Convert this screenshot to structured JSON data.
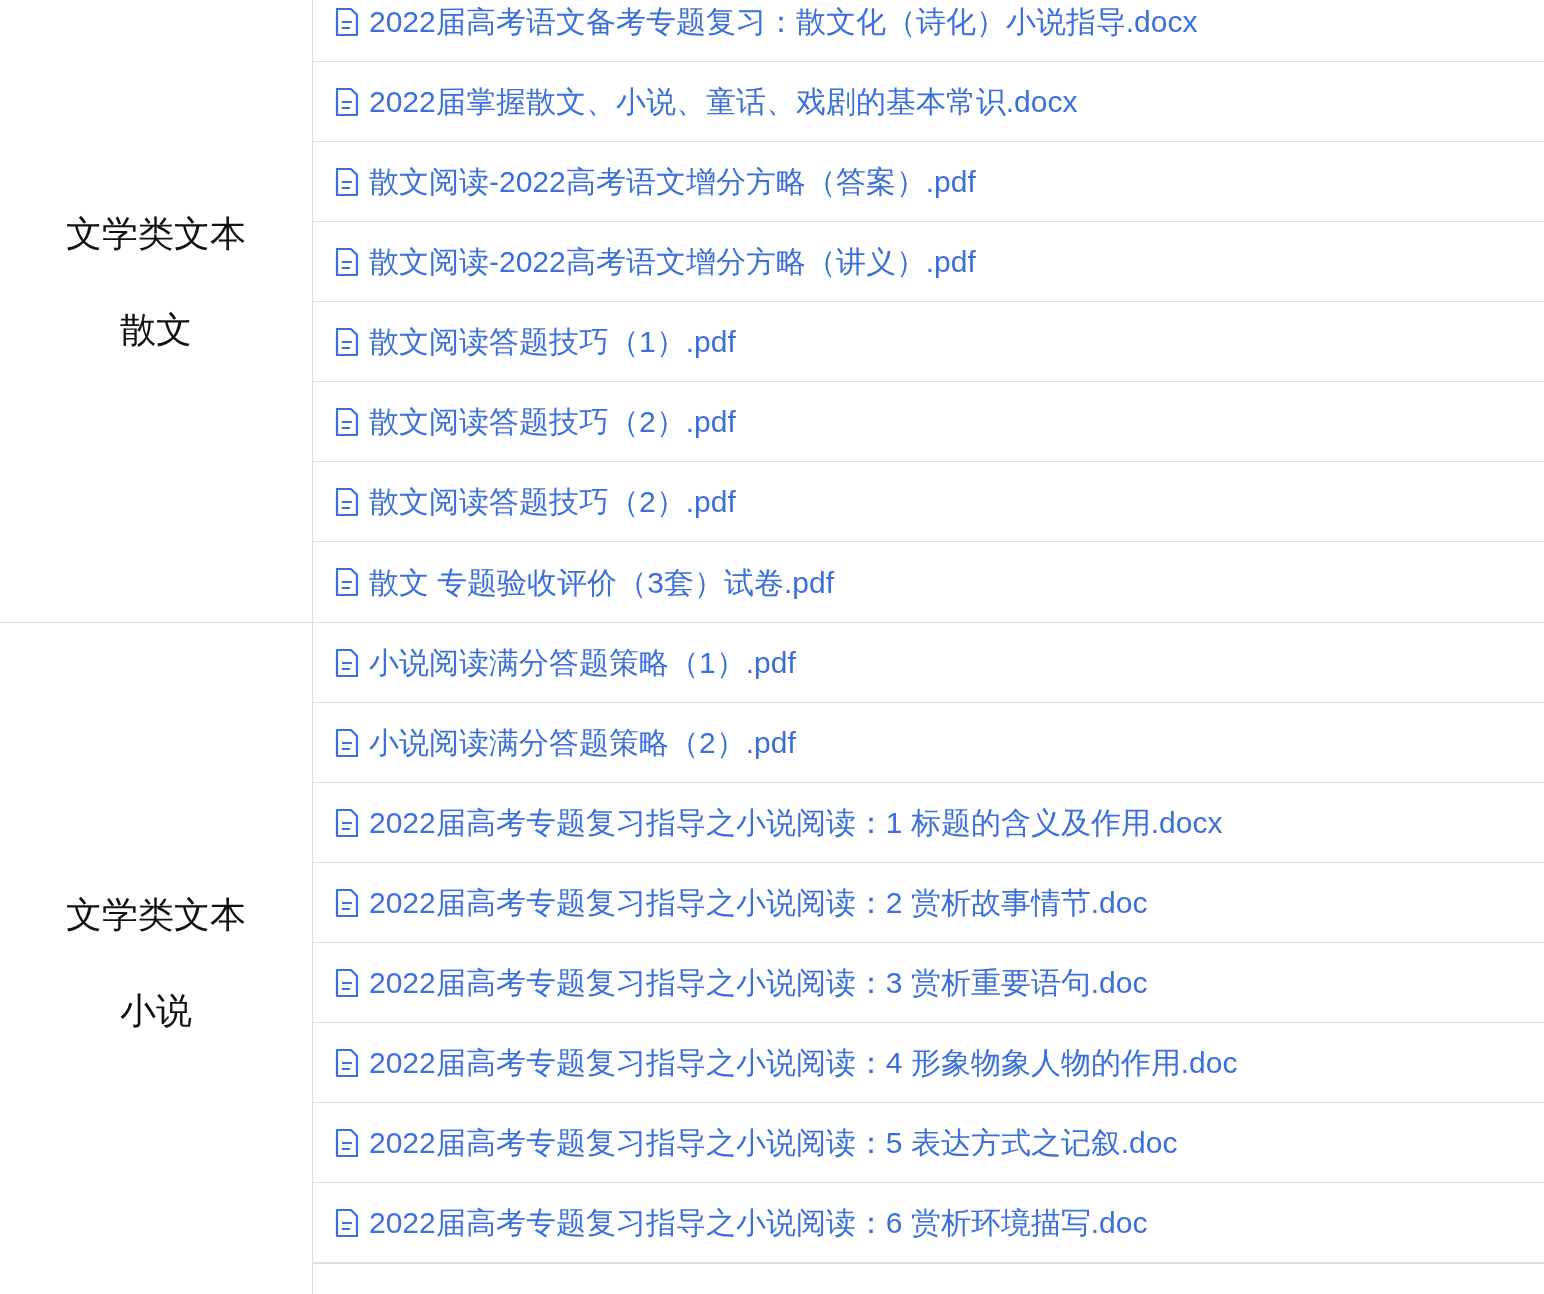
{
  "groups": [
    {
      "category": [
        "文学类文本",
        "散文"
      ],
      "files": [
        "2022届高考语文备考专题复习：散文化（诗化）小说指导.docx",
        "2022届掌握散文、小说、童话、戏剧的基本常识.docx",
        "散文阅读-2022高考语文增分方略（答案）.pdf",
        "散文阅读-2022高考语文增分方略（讲义）.pdf",
        "散文阅读答题技巧（1）.pdf",
        "散文阅读答题技巧（2）.pdf",
        "散文阅读答题技巧（2）.pdf",
        "散文 专题验收评价（3套）试卷.pdf"
      ]
    },
    {
      "category": [
        "文学类文本",
        "小说"
      ],
      "files": [
        "小说阅读满分答题策略（1）.pdf",
        "小说阅读满分答题策略（2）.pdf",
        "2022届高考专题复习指导之小说阅读：1 标题的含义及作用.docx",
        "2022届高考专题复习指导之小说阅读：2 赏析故事情节.doc",
        "2022届高考专题复习指导之小说阅读：3 赏析重要语句.doc",
        "2022届高考专题复习指导之小说阅读：4 形象物象人物的作用.doc",
        "2022届高考专题复习指导之小说阅读：5 表达方式之记叙.doc",
        "2022届高考专题复习指导之小说阅读：6 赏析环境描写.doc"
      ]
    }
  ]
}
